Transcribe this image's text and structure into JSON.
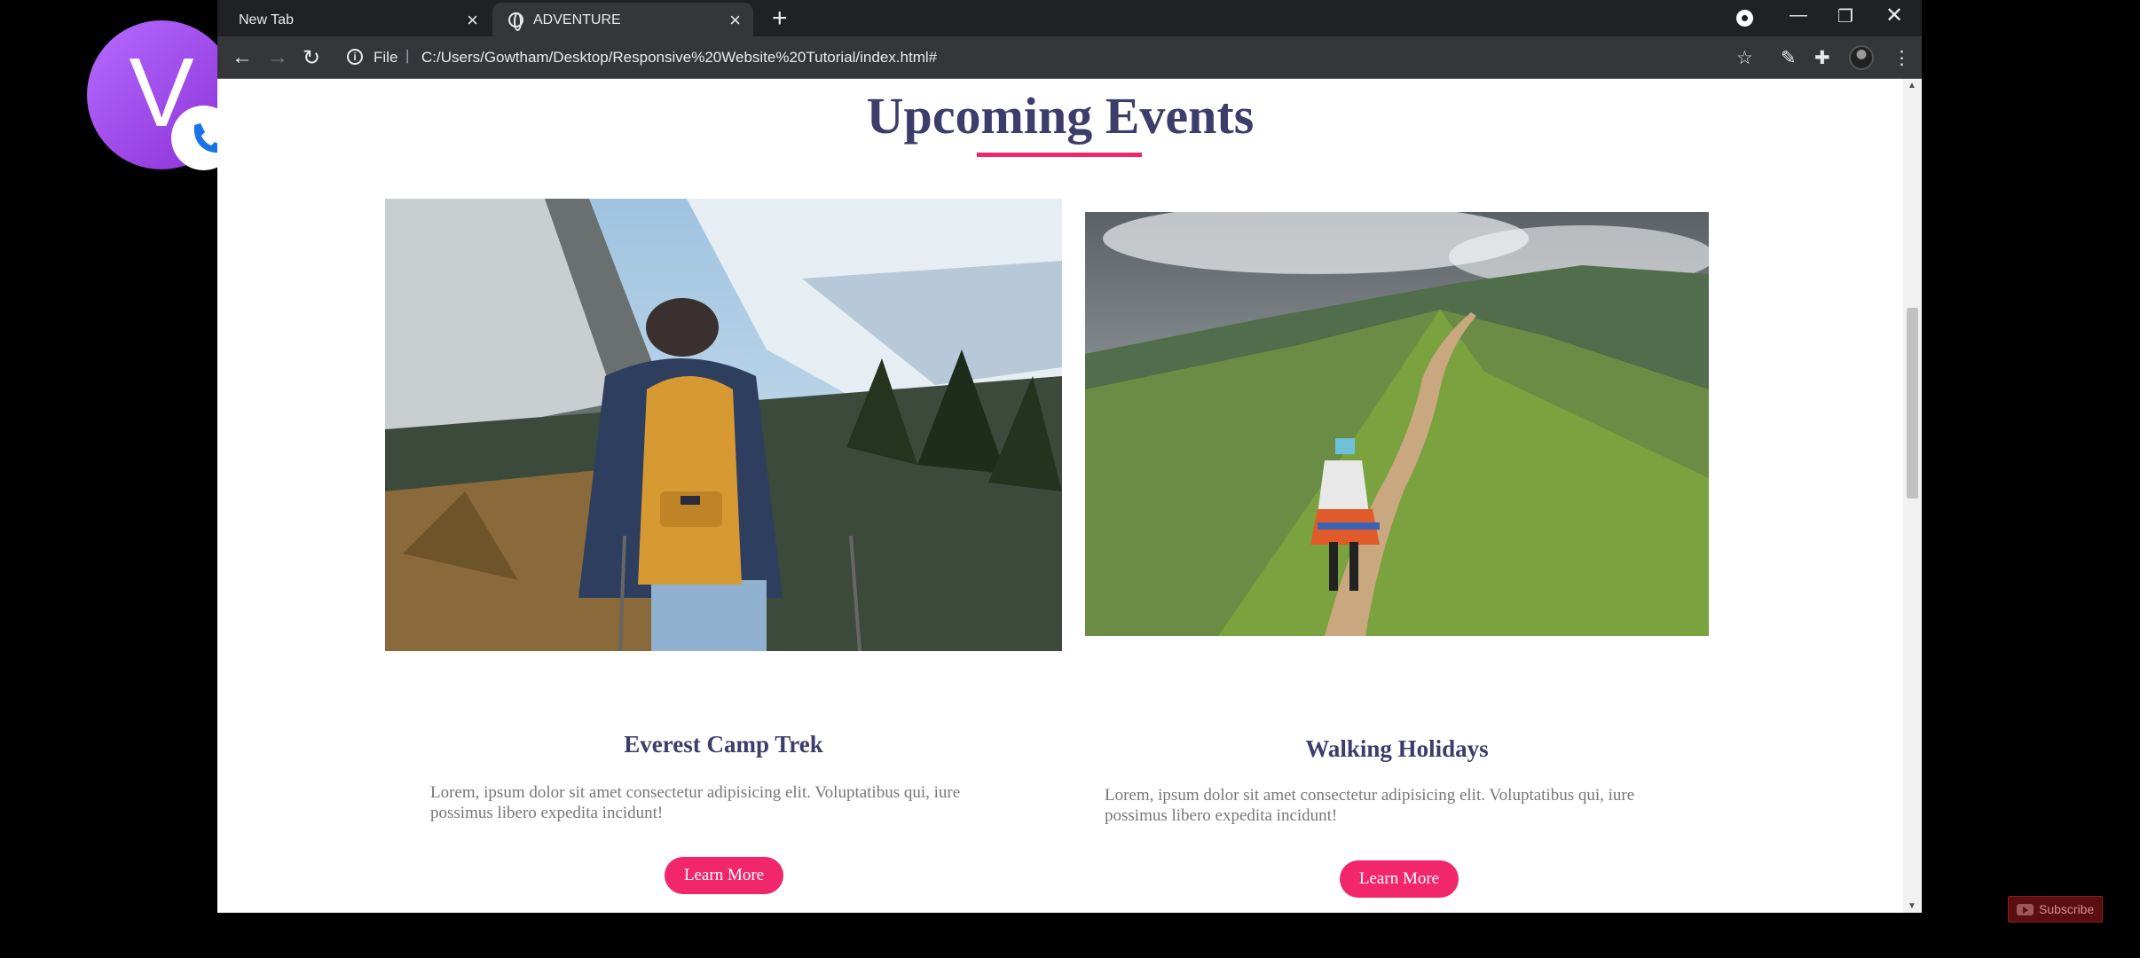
{
  "browser": {
    "tabs": [
      {
        "label": "New Tab",
        "active": false
      },
      {
        "label": "ADVENTURE",
        "active": true
      }
    ],
    "address": {
      "scheme_label": "File",
      "url": "C:/Users/Gowtham/Desktop/Responsive%20Website%20Tutorial/index.html#"
    },
    "icons": {
      "back": "back-arrow-icon",
      "forward": "forward-arrow-icon",
      "reload": "reload-icon",
      "bookmark": "star-icon",
      "extensions": "puzzle-icon",
      "menu": "kebab-menu-icon"
    }
  },
  "page": {
    "section_title": "Upcoming Events",
    "accent_color": "#f1266b",
    "heading_color": "#3d3d6b",
    "events": [
      {
        "title": "Everest Camp Trek",
        "description": "Lorem, ipsum dolor sit amet consectetur adipisicing elit. Voluptatibus qui, iure possimus libero expedita incidunt!",
        "button_label": "Learn More",
        "image": "hiker-with-yellow-backpack-in-snowy-mountains"
      },
      {
        "title": "Walking Holidays",
        "description": "Lorem, ipsum dolor sit amet consectetur adipisicing elit. Voluptatibus qui, iure possimus libero expedita incidunt!",
        "button_label": "Learn More",
        "image": "woman-walking-on-green-mountain-ridge-trail"
      }
    ]
  },
  "overlay": {
    "call_bubble_letter": "V",
    "subscribe_label": "Subscribe"
  }
}
